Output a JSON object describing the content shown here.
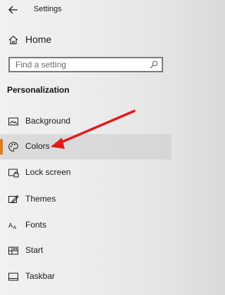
{
  "window": {
    "title": "Settings"
  },
  "nav": {
    "home_label": "Home"
  },
  "search": {
    "placeholder": "Find a setting"
  },
  "section": {
    "heading": "Personalization"
  },
  "items": [
    {
      "label": "Background",
      "icon": "picture-icon",
      "selected": false
    },
    {
      "label": "Colors",
      "icon": "palette-icon",
      "selected": true
    },
    {
      "label": "Lock screen",
      "icon": "lock-screen-icon",
      "selected": false
    },
    {
      "label": "Themes",
      "icon": "themes-icon",
      "selected": false
    },
    {
      "label": "Fonts",
      "icon": "fonts-icon",
      "selected": false
    },
    {
      "label": "Start",
      "icon": "start-icon",
      "selected": false
    },
    {
      "label": "Taskbar",
      "icon": "taskbar-icon",
      "selected": false
    }
  ],
  "colors": {
    "accent": "#e07b1f",
    "annotation_arrow": "#e21b1b"
  }
}
